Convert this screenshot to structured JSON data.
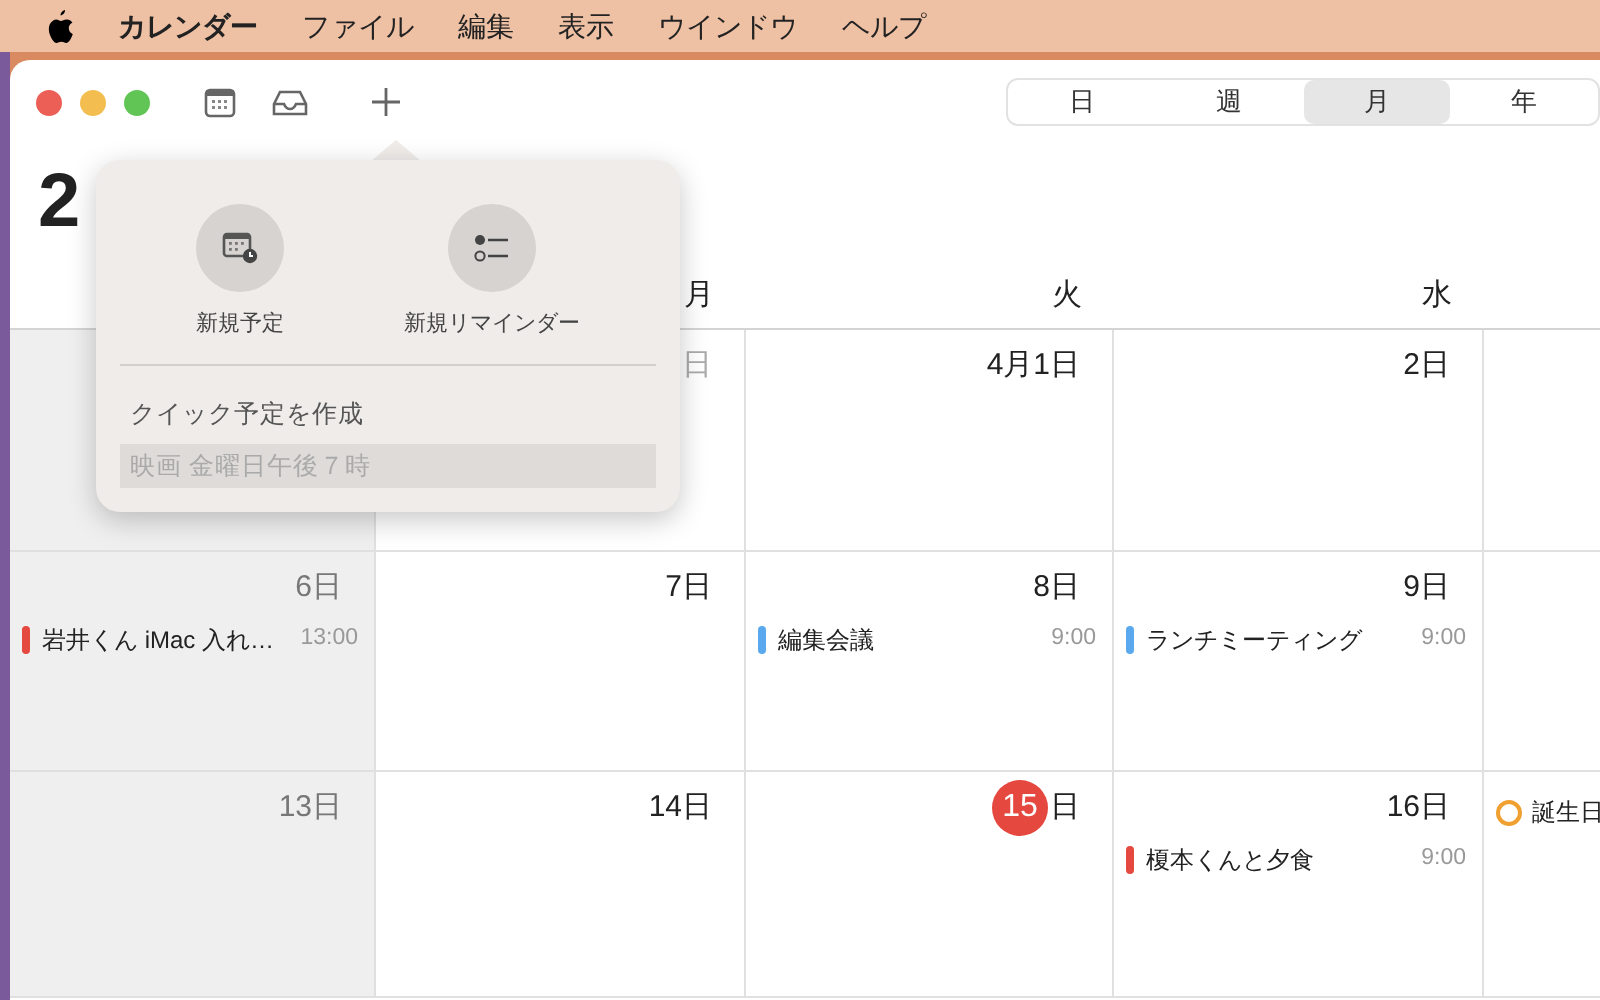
{
  "menu_bar": {
    "app": "カレンダー",
    "items": [
      "ファイル",
      "編集",
      "表示",
      "ウインドウ",
      "ヘルプ"
    ]
  },
  "toolbar": {
    "view_tabs": [
      {
        "label": "日",
        "selected": false
      },
      {
        "label": "週",
        "selected": false
      },
      {
        "label": "月",
        "selected": true
      },
      {
        "label": "年",
        "selected": false
      }
    ]
  },
  "title": "2",
  "popover": {
    "actions": [
      {
        "label": "新規予定",
        "kind": "event"
      },
      {
        "label": "新規リマインダー",
        "kind": "reminder"
      }
    ],
    "quick_label": "クイック予定を作成",
    "quick_placeholder": "映画 金曜日午後７時"
  },
  "weekday_headers": [
    "月",
    "火",
    "水"
  ],
  "weeks": [
    {
      "days": [
        {
          "weekend": true
        },
        {
          "date": "日",
          "other_month": true
        },
        {
          "date": "4月1日"
        },
        {
          "date": "2日"
        },
        {
          "weekend": false
        }
      ]
    },
    {
      "days": [
        {
          "date": "6日",
          "weekend": true,
          "events": [
            {
              "kind": "timed",
              "title": "岩井くん iMac 入れ…",
              "time": "13:00",
              "color": "#e5483e"
            }
          ]
        },
        {
          "date": "7日"
        },
        {
          "date": "8日",
          "events": [
            {
              "kind": "timed",
              "title": "編集会議",
              "time": "9:00",
              "color": "#5aa9ef"
            }
          ]
        },
        {
          "date": "9日",
          "events": [
            {
              "kind": "timed",
              "title": "ランチミーティング",
              "time": "9:00",
              "color": "#5aa9ef"
            }
          ]
        },
        {
          "weekend": false
        }
      ]
    },
    {
      "days": [
        {
          "date": "13日",
          "weekend": true
        },
        {
          "date": "14日"
        },
        {
          "date": "15",
          "suffix": "日",
          "today": true
        },
        {
          "date": "16日",
          "events": [
            {
              "kind": "timed",
              "title": "榎本くんと夕食",
              "time": "9:00",
              "color": "#e5483e"
            }
          ]
        },
        {
          "events": [
            {
              "kind": "allday",
              "title": "誕生日",
              "color": "#f0a030"
            }
          ]
        }
      ]
    }
  ]
}
